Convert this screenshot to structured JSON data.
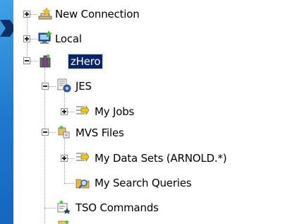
{
  "tree": {
    "new_connection": "New Connection",
    "local": "Local",
    "zhero": "zHero",
    "jes": "JES",
    "my_jobs": "My Jobs",
    "mvs_files": "MVS Files",
    "my_data_sets": "My Data Sets (ARNOLD.*)",
    "my_search_queries": "My Search Queries",
    "tso_commands": "TSO Commands"
  }
}
